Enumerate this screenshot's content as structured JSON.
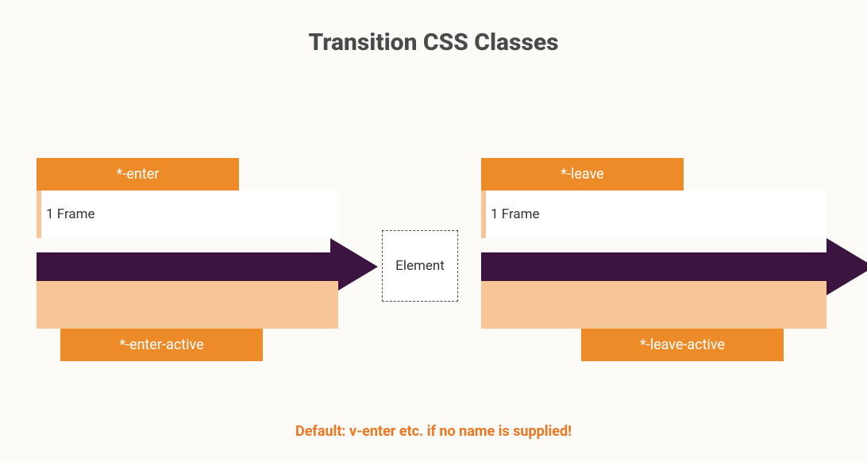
{
  "title": "Transition CSS Classes",
  "footer": "Default: v-enter etc. if no name is supplied!",
  "left": {
    "top_label": "*-enter",
    "frame_label": "1 Frame",
    "bottom_label": "*-enter-active"
  },
  "center": {
    "element_label": "Element"
  },
  "right": {
    "top_label": "*-leave",
    "frame_label": "1 Frame",
    "bottom_label": "*-leave-active"
  },
  "colors": {
    "orange": "#ed8b29",
    "peach": "#f8c696",
    "arrow": "#3b153f",
    "accent_text": "#ed7621"
  }
}
